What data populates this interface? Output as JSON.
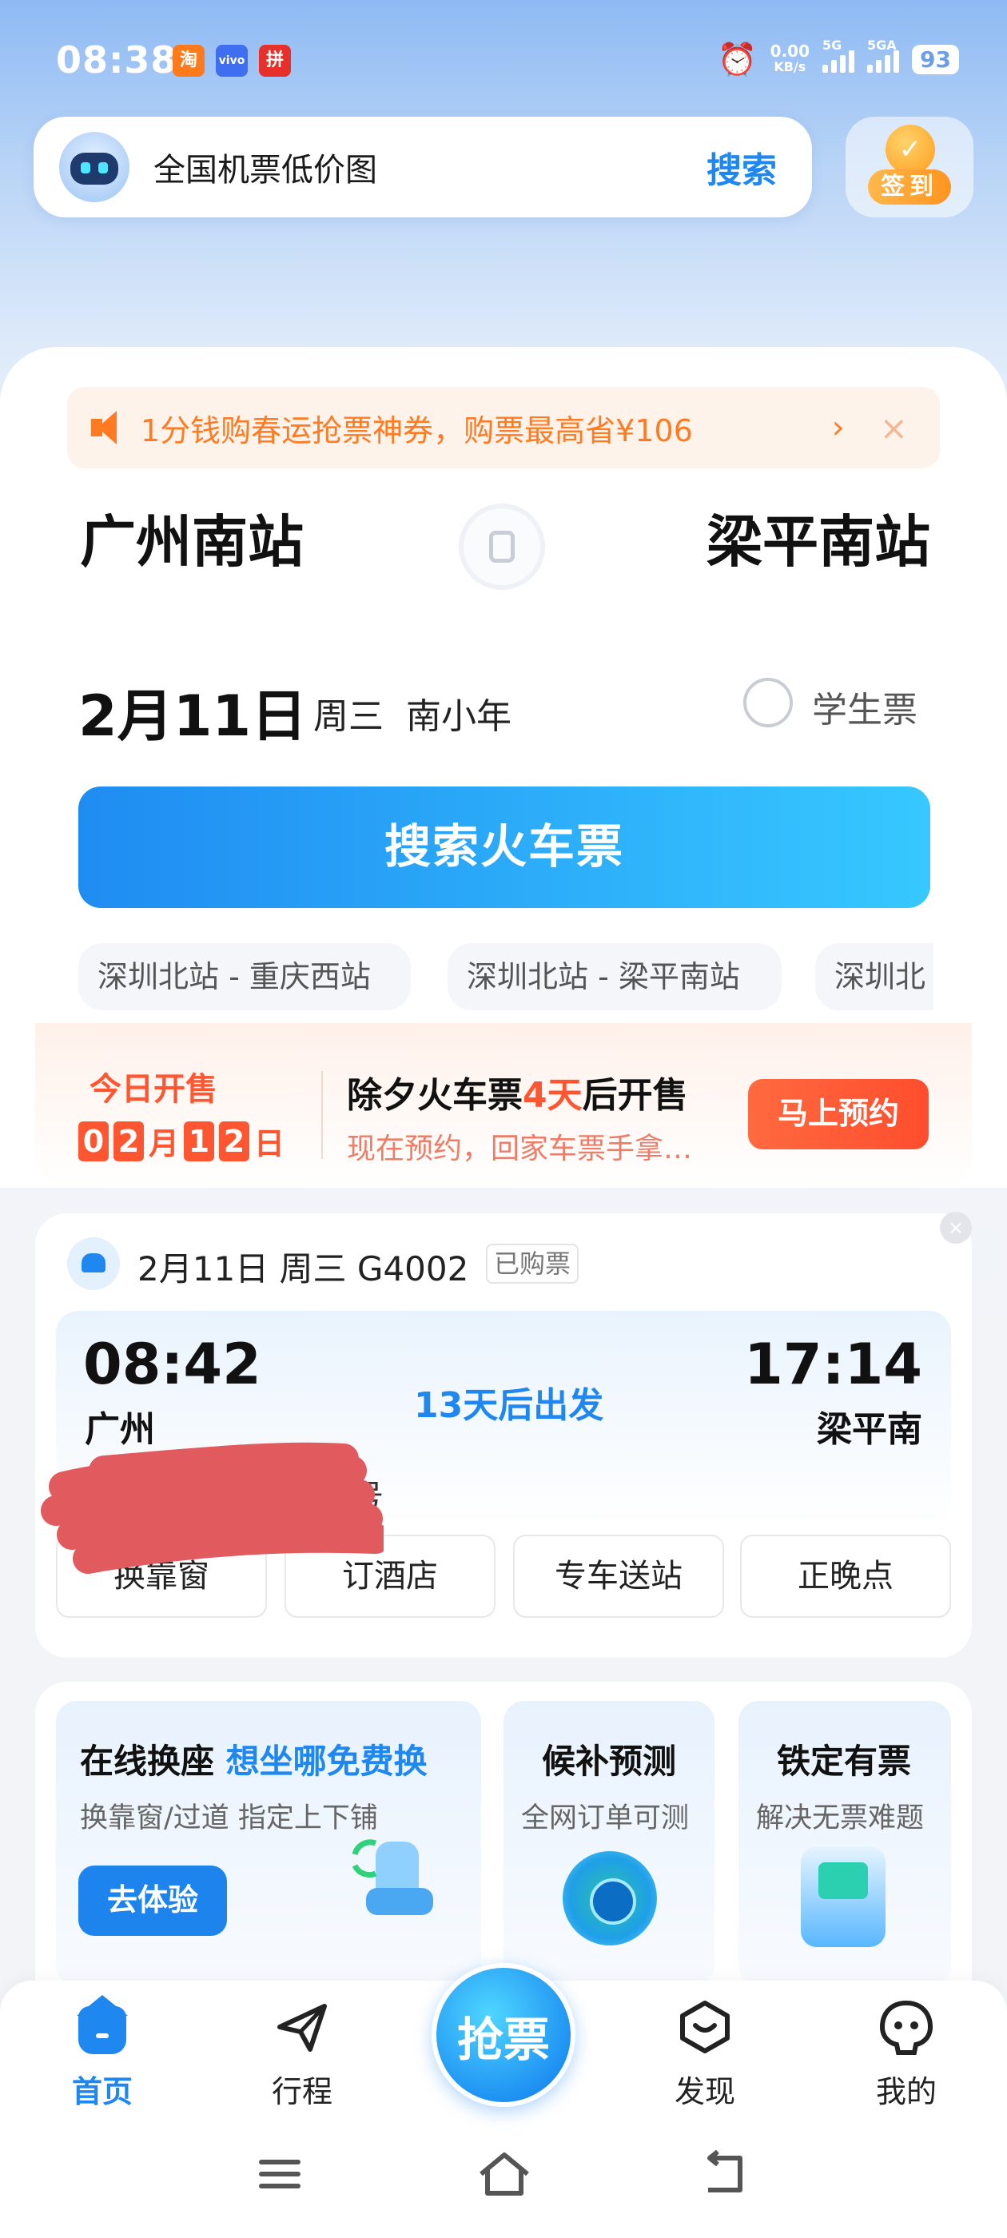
{
  "status": {
    "time": "08:38",
    "apps": [
      "淘",
      "vivo",
      "拼"
    ],
    "network_speed": "0.00",
    "network_unit": "KB/s",
    "signal1": "5G",
    "signal2": "5GA",
    "battery": "93"
  },
  "top": {
    "search_text": "全国机票低价图",
    "search_button": "搜索",
    "signin": "签到"
  },
  "notice": {
    "text": "1分钱购春运抢票神券，购票最高省¥106",
    "arrow": "›",
    "close": "×"
  },
  "route": {
    "from": "广州南站",
    "to": "梁平南站",
    "date": "2月11日",
    "weekday": "周三",
    "festival": "南小年",
    "student_label": "学生票",
    "search_button": "搜索火车票"
  },
  "history": [
    "深圳北站 - 重庆西站",
    "深圳北站 - 梁平南站",
    "深圳北"
  ],
  "sale": {
    "label": "今日开售",
    "digits": [
      "0",
      "2",
      "1",
      "2"
    ],
    "month": "月",
    "day": "日",
    "title_pre": "除夕火车票",
    "title_hl": "4天",
    "title_post": "后开售",
    "subtitle": "现在预约，回家车票手拿…",
    "button": "马上预约"
  },
  "trip": {
    "header": "2月11日 周三 G4002",
    "status": "已购票",
    "close": "×",
    "depart_time": "08:42",
    "arrive_time": "17:14",
    "depart_station": "广州",
    "arrive_station": "梁平南",
    "countdown": "13天后出发",
    "seat_tail": "号",
    "actions": [
      "换靠窗",
      "订酒店",
      "专车送站",
      "正晚点"
    ]
  },
  "services": {
    "swap_title": "在线换座",
    "swap_highlight": "想坐哪免费换",
    "swap_sub": "换靠窗/过道 指定上下铺",
    "swap_button": "去体验",
    "predict_title": "候补预测",
    "predict_sub": "全网订单可测",
    "sure_title": "铁定有票",
    "sure_sub": "解决无票难题"
  },
  "nav": {
    "home": "首页",
    "trip": "行程",
    "grab": "抢票",
    "discover": "发现",
    "mine": "我的"
  },
  "colors": {
    "brand_blue": "#1f87f0",
    "sale_red": "#ff5631",
    "notice_orange": "#ff7a21"
  }
}
